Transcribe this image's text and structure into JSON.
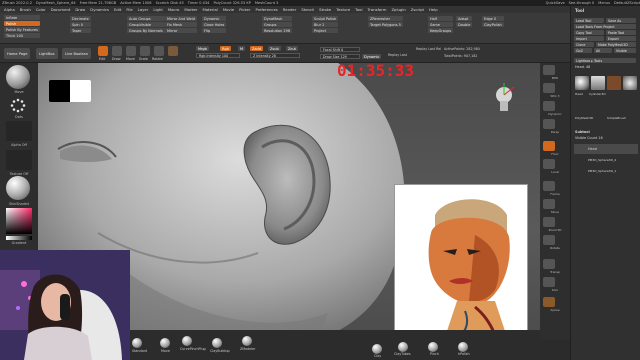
{
  "titlebar": {
    "items": [
      "ZBrush 2022.0.2",
      "DynaMesh_Sphere_64",
      "Free Mem 21.798GB",
      "Active Mem 1006",
      "Scratch Disk 45",
      "Timer 0.034",
      "PolyCount 326.53 KP",
      "MeshCount 3"
    ],
    "right": [
      "QuickSave",
      "See-through 0",
      "Menus",
      "DefaultZScript"
    ]
  },
  "menubar": {
    "items": [
      "Alpha",
      "Brush",
      "Color",
      "Document",
      "Draw",
      "Dynamics",
      "Edit",
      "File",
      "Layer",
      "Light",
      "Macro",
      "Marker",
      "Material",
      "Movie",
      "Picker",
      "Preferences",
      "Render",
      "Stencil",
      "Stroke",
      "Texture",
      "Tool",
      "Transform",
      "Zplugin",
      "Zscript",
      "Help"
    ],
    "right": [
      "Tool"
    ]
  },
  "palettes": {
    "left": [
      "Inflate",
      "Polish",
      "Polish By Features",
      "Thick 100"
    ],
    "col2": [
      "Decimate",
      "Spin 0",
      "Taper"
    ],
    "col3": [
      "Auto Groups",
      "GroupVisible",
      "Groups By Normals"
    ],
    "col4": [
      "Mirror And Weld",
      "Fix Mesh",
      "Mirror"
    ],
    "col5": [
      "Dynamic",
      "Close Holes",
      "Flip"
    ],
    "col6": [
      "DynaMesh",
      "Groups",
      "Resolution 296"
    ],
    "col7": [
      "Sculpt Polish",
      "Blur 2",
      "Project"
    ],
    "col8": [
      "ZRemesher",
      "Target Polygons 5"
    ],
    "col9": [
      "Half",
      "Same",
      "KeepGroups"
    ],
    "col10": [
      "Adapt",
      "Double"
    ],
    "col11": [
      "Edge 0",
      "ClayPolish"
    ]
  },
  "shelf": {
    "buttons": [
      "Home Page",
      "LightBox",
      "Live Boolean"
    ],
    "tools": [
      "Edit",
      "Draw",
      "Move",
      "Scale",
      "Rotate"
    ],
    "mrgb": "Mrgb",
    "rgb": "Rgb",
    "m": "M",
    "zadd": "Zadd",
    "zsub": "Zsub",
    "zcut": "Zcut",
    "rgb_intensity": "Rgb Intensity 100",
    "z_intensity": "Z Intensity 28",
    "focal_shift": "Focal Shift 0",
    "draw_size": "Draw Size 129",
    "dynamic": "Dynamic",
    "active_points": "ActivePoints: 282,984",
    "total_points": "TotalPoints: 907,182",
    "replay": "Replay Last",
    "replay_rel": "Replay Last Rel"
  },
  "lefttray": {
    "brush": "Move",
    "stroke": "Dots",
    "alpha": "Alpha Off",
    "texture": "Texture Off",
    "material": "SkinShade4",
    "gradient": "Gradient",
    "switch": "SwitchColor"
  },
  "timer": {
    "value": "01:35:33"
  },
  "righttray": {
    "buttons": [
      "BPR",
      "SPix 3",
      "Dynamic",
      "Persp",
      "Floor",
      "Local",
      "Frame",
      "Move",
      "Zoom3D",
      "Rotate",
      "Transp",
      "Solo",
      "Xpose"
    ]
  },
  "toolpanel": {
    "title": "Tool",
    "buttons": [
      "Load Tool",
      "Save As",
      "Load Tools From Project",
      "Copy Tool",
      "Paste Tool",
      "Import",
      "Export",
      "Clone",
      "Make PolyMesh3D",
      "GoZ",
      "All",
      "Visible"
    ],
    "lightbox": "Lightbox ▸ Tools",
    "head_label": "Head. 48",
    "thumbs": [
      "Head",
      "Cylinder3D",
      "PolyMesh3D",
      "SimpleBrush"
    ],
    "subtool": "Subtool",
    "visible_count": "Visible Count 16",
    "subtools": [
      "Head",
      "PM3D_Sphere3D_2",
      "PM3D_Sphere3D_1"
    ]
  },
  "bottombar": {
    "items": [
      "Standard",
      "Move",
      "CurvePinchPlug",
      "ClayBuildup",
      "ZModeler",
      "Clay",
      "ClayTubes",
      "Pinch",
      "hPolish"
    ]
  },
  "reference": {
    "alt": "Illustrated portrait reference"
  }
}
